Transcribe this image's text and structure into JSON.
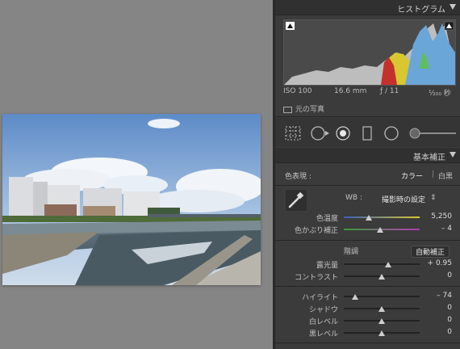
{
  "panel": {
    "histogram_title": "ヒストグラム",
    "exif": {
      "iso": "ISO 100",
      "focal": "16.6 mm",
      "aperture": "ƒ / 11",
      "shutter": "¹⁄₂₀₀ 秒"
    },
    "original_photo_label": "元の写真",
    "basic_title": "基本補正",
    "treatment": {
      "label": "色表現 :",
      "color": "カラー",
      "separator": "|",
      "bw": "白黒"
    },
    "wb": {
      "label": "WB :",
      "value": "撮影時の設定",
      "arrow": "⇕"
    },
    "sliders_wb": [
      {
        "label": "色温度",
        "value": "5,250",
        "pos": 0.33
      },
      {
        "label": "色かぶり補正",
        "value": "– 4",
        "pos": 0.48
      }
    ],
    "tone": {
      "label": "階調",
      "auto_label": "自動補正"
    },
    "sliders_tone": [
      {
        "label": "露光量",
        "value": "+ 0.95",
        "pos": 0.58
      },
      {
        "label": "コントラスト",
        "value": "0",
        "pos": 0.5
      }
    ],
    "sliders_presence": [
      {
        "label": "ハイライト",
        "value": "– 74",
        "pos": 0.15
      },
      {
        "label": "シャドウ",
        "value": "0",
        "pos": 0.5
      },
      {
        "label": "白レベル",
        "value": "0",
        "pos": 0.5
      },
      {
        "label": "黒レベル",
        "value": "0",
        "pos": 0.5
      }
    ]
  },
  "icons": [
    "triangle-down-icon",
    "shadow-clip-icon",
    "highlight-clip-icon",
    "crop-grid-icon",
    "spot-removal-icon",
    "redeye-icon",
    "graduated-filter-icon",
    "radial-filter-icon",
    "adjustment-brush-icon",
    "eyedropper-icon"
  ]
}
